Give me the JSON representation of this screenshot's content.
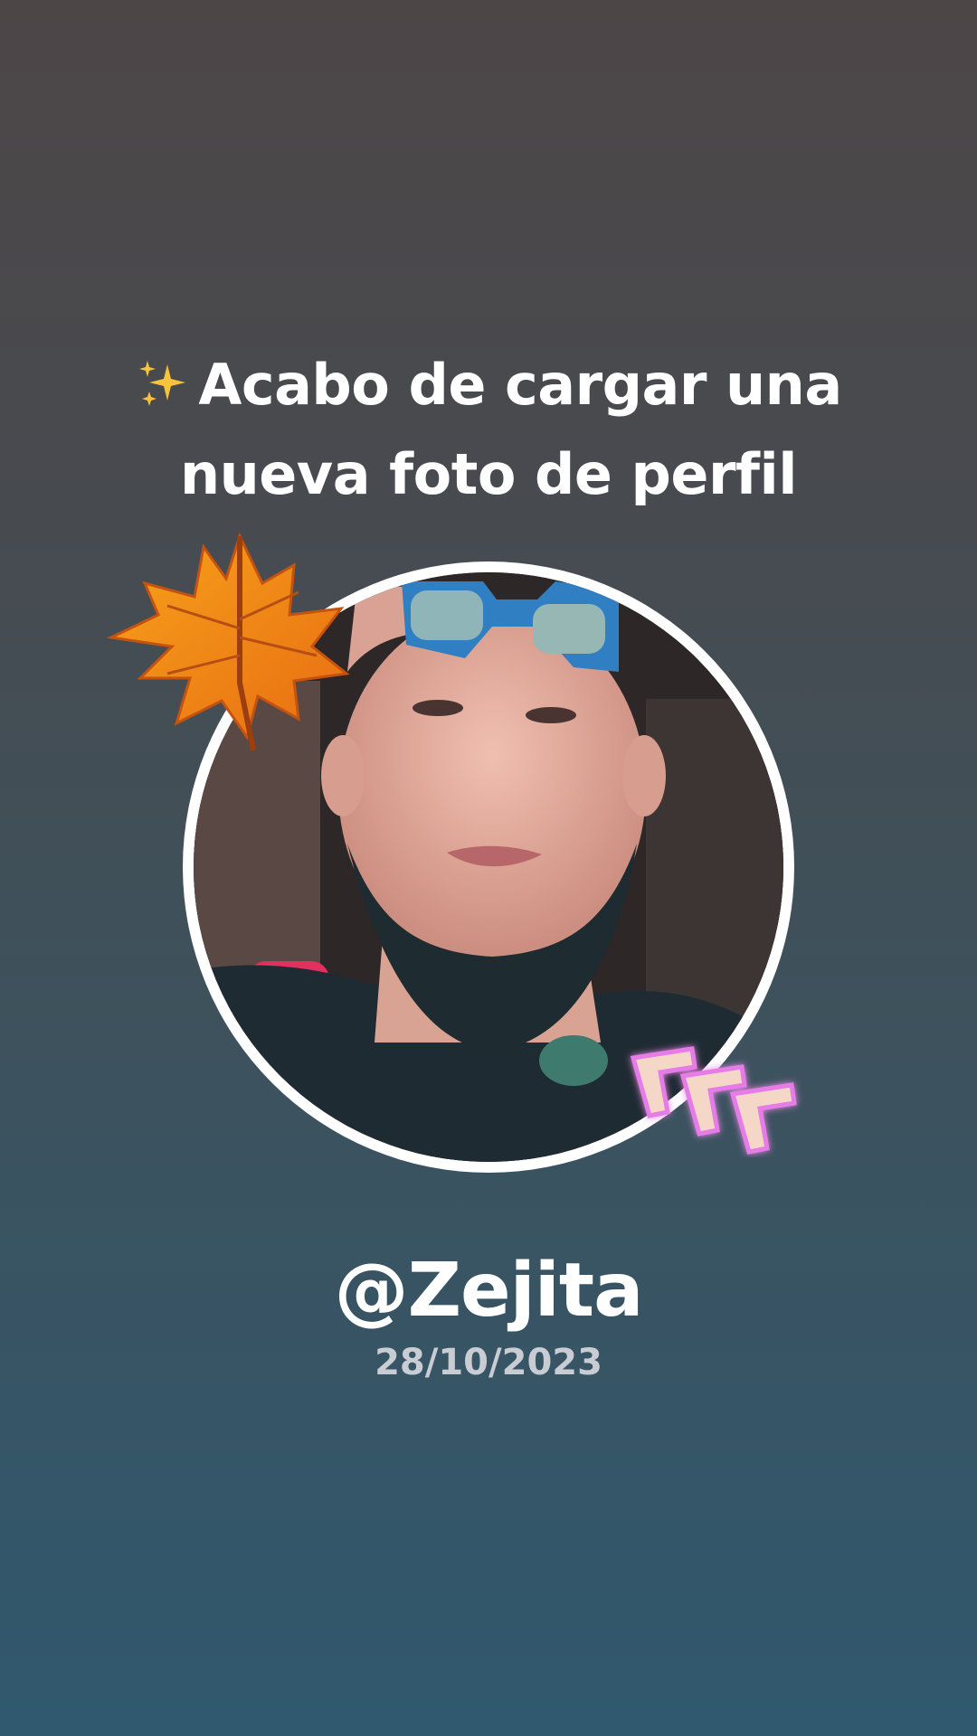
{
  "headline": {
    "icon": "sparkles-icon",
    "line1": "Acabo de cargar una",
    "line2": "nueva foto de perfil"
  },
  "avatar": {
    "description_icon": "profile-photo",
    "decorations": [
      "maple-leaf-icon",
      "neon-chevrons-icon"
    ]
  },
  "profile": {
    "username": "@Zejita",
    "date": "28/10/2023"
  },
  "colors": {
    "background_top": "#4d4647",
    "background_bottom": "#30586e",
    "text": "#ffffff",
    "date_text": "#c9cdd3",
    "ring": "#ffffff",
    "leaf": "#f08a1c",
    "neon": "#e77be8"
  }
}
